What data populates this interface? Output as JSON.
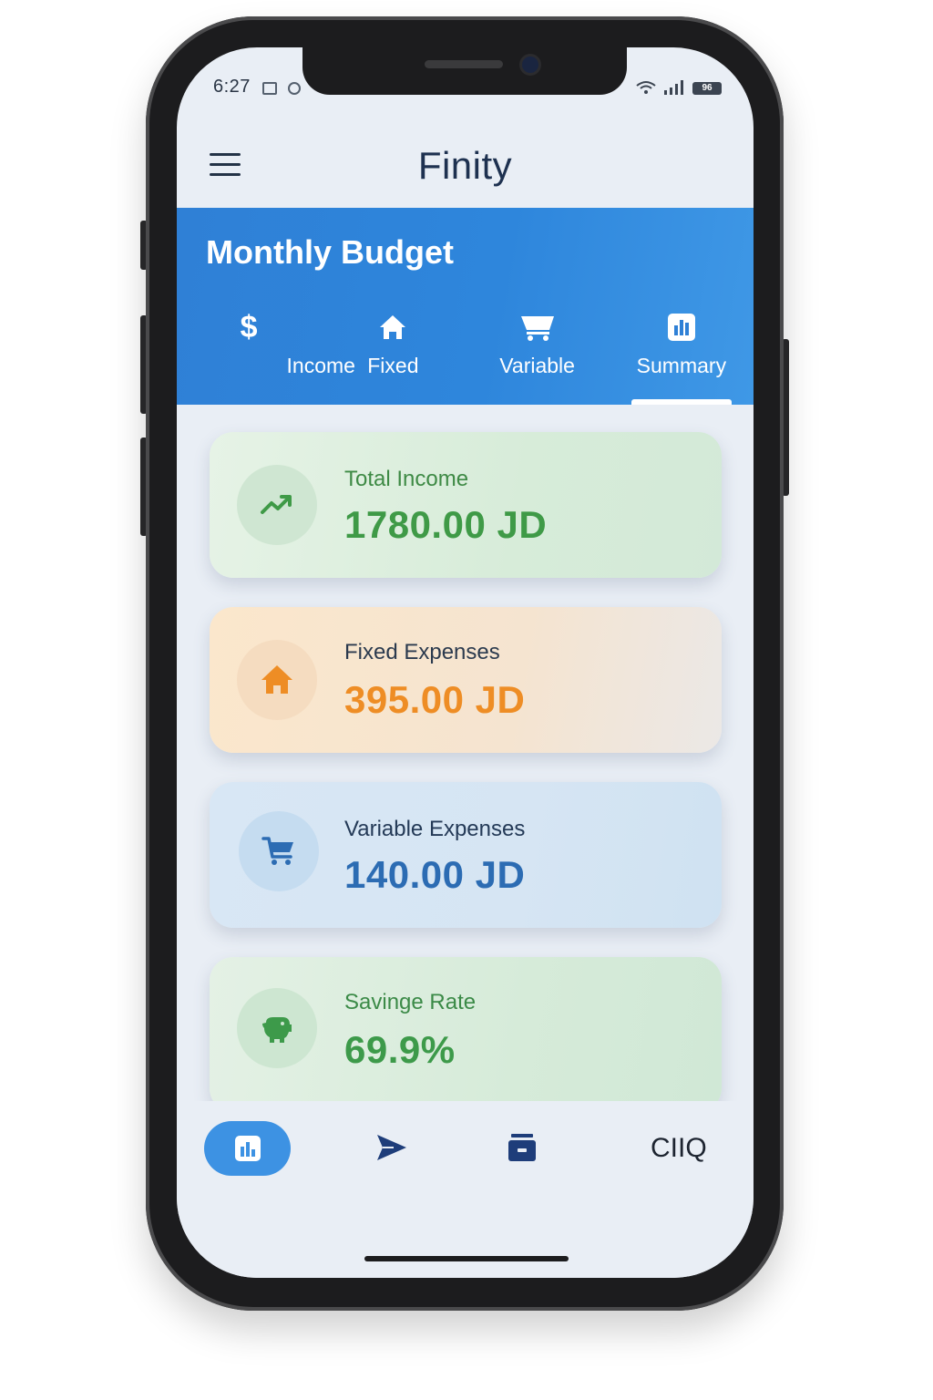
{
  "status_bar": {
    "time": "6:27",
    "battery": "96"
  },
  "header": {
    "title": "Finity",
    "menu_icon": "hamburger-menu-icon"
  },
  "banner": {
    "title": "Monthly Budget",
    "tabs": [
      {
        "label": "Income",
        "icon": "dollar-icon",
        "active": false
      },
      {
        "label": "Fixed",
        "icon": "house-icon",
        "active": false
      },
      {
        "label": "Variable",
        "icon": "cart-icon",
        "active": false
      },
      {
        "label": "Summary",
        "icon": "bar-chart-icon",
        "active": true
      }
    ]
  },
  "cards": [
    {
      "label": "Total Income",
      "value": "1780.00 JD",
      "icon": "trending-up-icon",
      "color": "#3f9a47"
    },
    {
      "label": "Fixed Expenses",
      "value": "395.00 JD",
      "icon": "house-icon",
      "color": "#ee8d25"
    },
    {
      "label": "Variable Expenses",
      "value": "140.00 JD",
      "icon": "cart-icon",
      "color": "#2c6cb3"
    },
    {
      "label": "Savinge Rate",
      "value": "69.9%",
      "icon": "piggy-bank-icon",
      "color": "#3d9a4a"
    }
  ],
  "bottom_nav": {
    "items": [
      {
        "icon": "bar-chart-icon",
        "active": true
      },
      {
        "icon": "send-icon",
        "active": false
      },
      {
        "icon": "archive-icon",
        "active": false
      },
      {
        "label": "CIIQ",
        "active": false
      }
    ]
  },
  "colors": {
    "accent": "#2f80d6",
    "background": "#e9eef5",
    "title": "#1e3150"
  }
}
